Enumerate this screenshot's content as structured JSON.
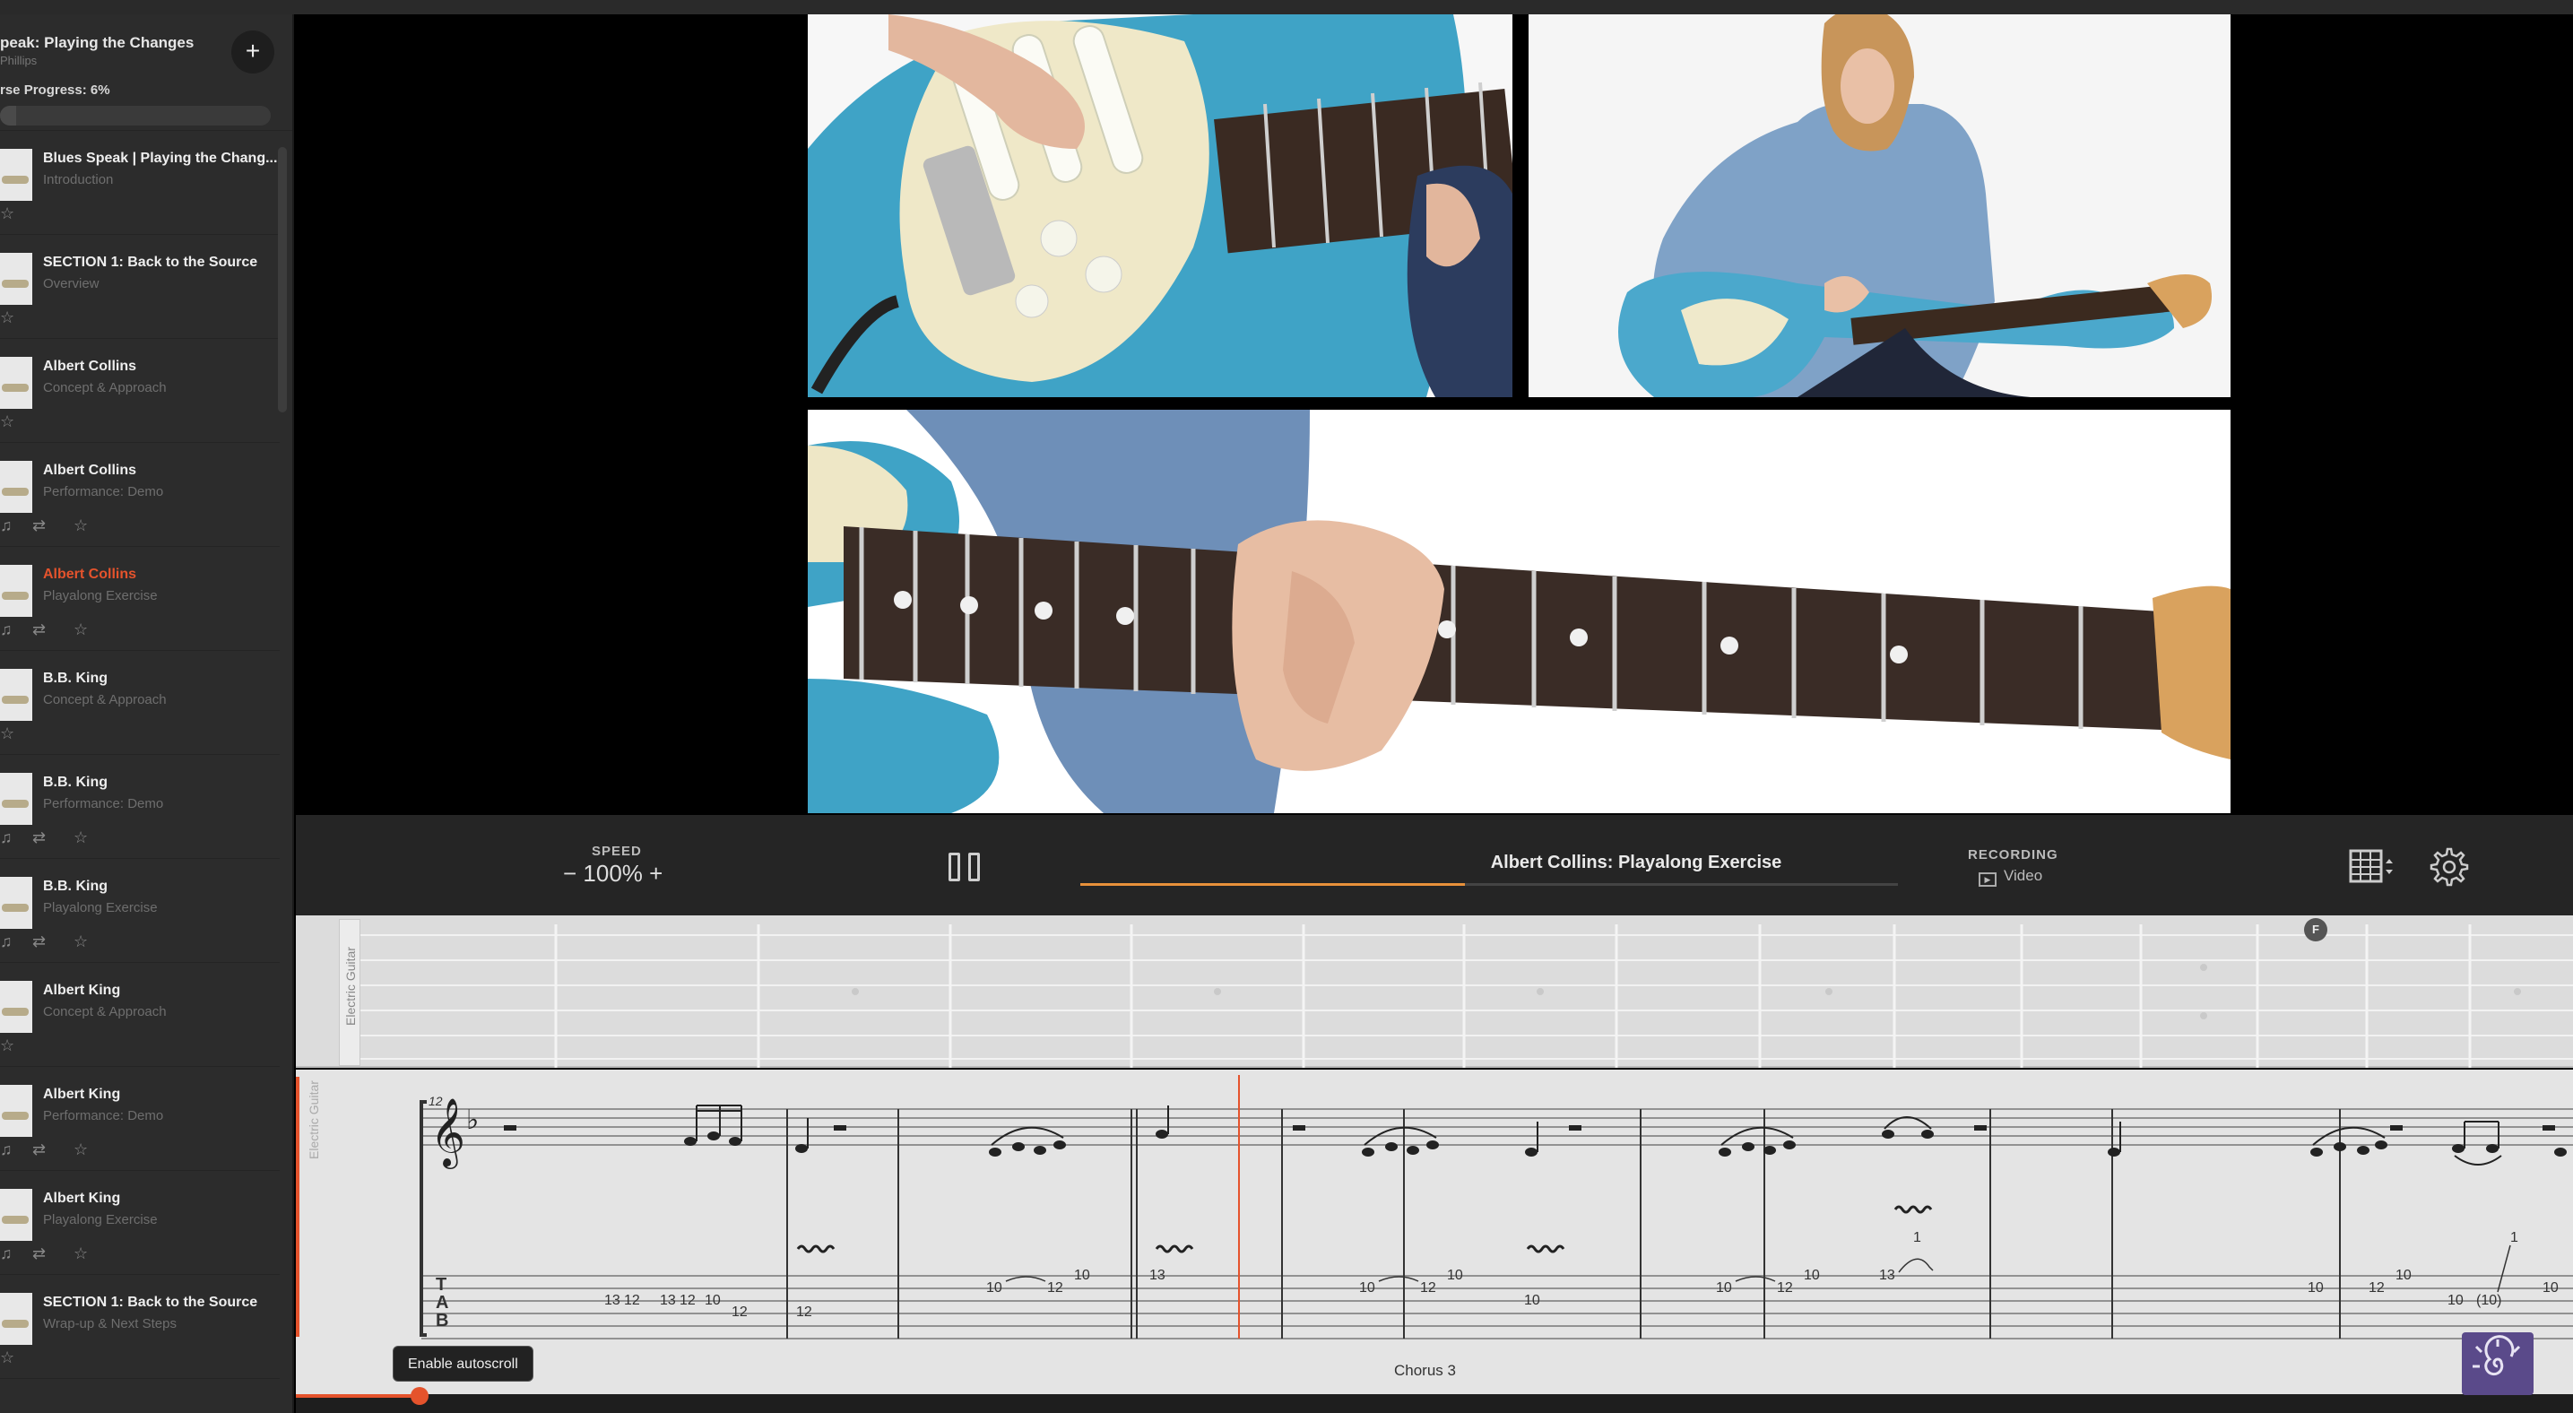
{
  "course": {
    "title": "peak: Playing the Changes",
    "subtitle": "Phillips",
    "progress_label": "rse Progress: 6%",
    "progress_percent": 6,
    "add_symbol": "+"
  },
  "lessons": [
    {
      "title": "Blues Speak | Playing the Chang...",
      "subtitle": "Introduction",
      "active": false,
      "icons": [
        "star-icon"
      ]
    },
    {
      "title": "SECTION 1: Back to the Source",
      "subtitle": "Overview",
      "active": false,
      "icons": [
        "star-icon"
      ]
    },
    {
      "title": "Albert Collins",
      "subtitle": "Concept & Approach",
      "active": false,
      "icons": [
        "star-icon"
      ]
    },
    {
      "title": "Albert Collins",
      "subtitle": "Performance: Demo",
      "active": false,
      "icons": [
        "music-icon",
        "mixer-icon",
        "star-icon"
      ]
    },
    {
      "title": "Albert Collins",
      "subtitle": "Playalong Exercise",
      "active": true,
      "icons": [
        "music-icon",
        "mixer-icon",
        "star-icon"
      ]
    },
    {
      "title": "B.B. King",
      "subtitle": "Concept & Approach",
      "active": false,
      "icons": [
        "star-icon"
      ]
    },
    {
      "title": "B.B. King",
      "subtitle": "Performance: Demo",
      "active": false,
      "icons": [
        "music-icon",
        "mixer-icon",
        "star-icon"
      ]
    },
    {
      "title": "B.B. King",
      "subtitle": "Playalong Exercise",
      "active": false,
      "icons": [
        "music-icon",
        "mixer-icon",
        "star-icon"
      ]
    },
    {
      "title": "Albert King",
      "subtitle": "Concept & Approach",
      "active": false,
      "icons": [
        "star-icon"
      ]
    },
    {
      "title": "Albert King",
      "subtitle": "Performance: Demo",
      "active": false,
      "icons": [
        "music-icon",
        "mixer-icon",
        "star-icon"
      ]
    },
    {
      "title": "Albert King",
      "subtitle": "Playalong Exercise",
      "active": false,
      "icons": [
        "music-icon",
        "mixer-icon",
        "star-icon"
      ]
    },
    {
      "title": "SECTION 1: Back to the Source",
      "subtitle": "Wrap-up & Next Steps",
      "active": false,
      "icons": [
        "star-icon"
      ]
    }
  ],
  "player": {
    "speed_label": "SPEED",
    "speed_value": "100%",
    "speed_minus": "−",
    "speed_plus": "+",
    "track_title": "Albert Collins: Playalong Exercise",
    "track_progress": 0.47,
    "recording_label": "RECORDING",
    "recording_value": "Video"
  },
  "fretboard": {
    "instrument_label": "Electric Guitar",
    "marker_label": "F"
  },
  "notation": {
    "instrument_label": "Electric Guitar",
    "tab_letters": [
      "T",
      "A",
      "B"
    ],
    "section_label": "Chorus 3",
    "autoscroll_label": "Enable autoscroll",
    "measure_number": "12",
    "tab_numbers": [
      "13",
      "12",
      "13",
      "12",
      "10",
      "12",
      "12",
      "10",
      "12",
      "10",
      "13",
      "10",
      "12",
      "10",
      "10",
      "10",
      "12",
      "10",
      "1",
      "13",
      "10",
      "12",
      "10",
      "1",
      "10",
      "(10)",
      "10"
    ]
  },
  "colors": {
    "accent": "#e5532c",
    "track_progress": "#e8913a",
    "logo_bg": "#5a4a8a"
  }
}
